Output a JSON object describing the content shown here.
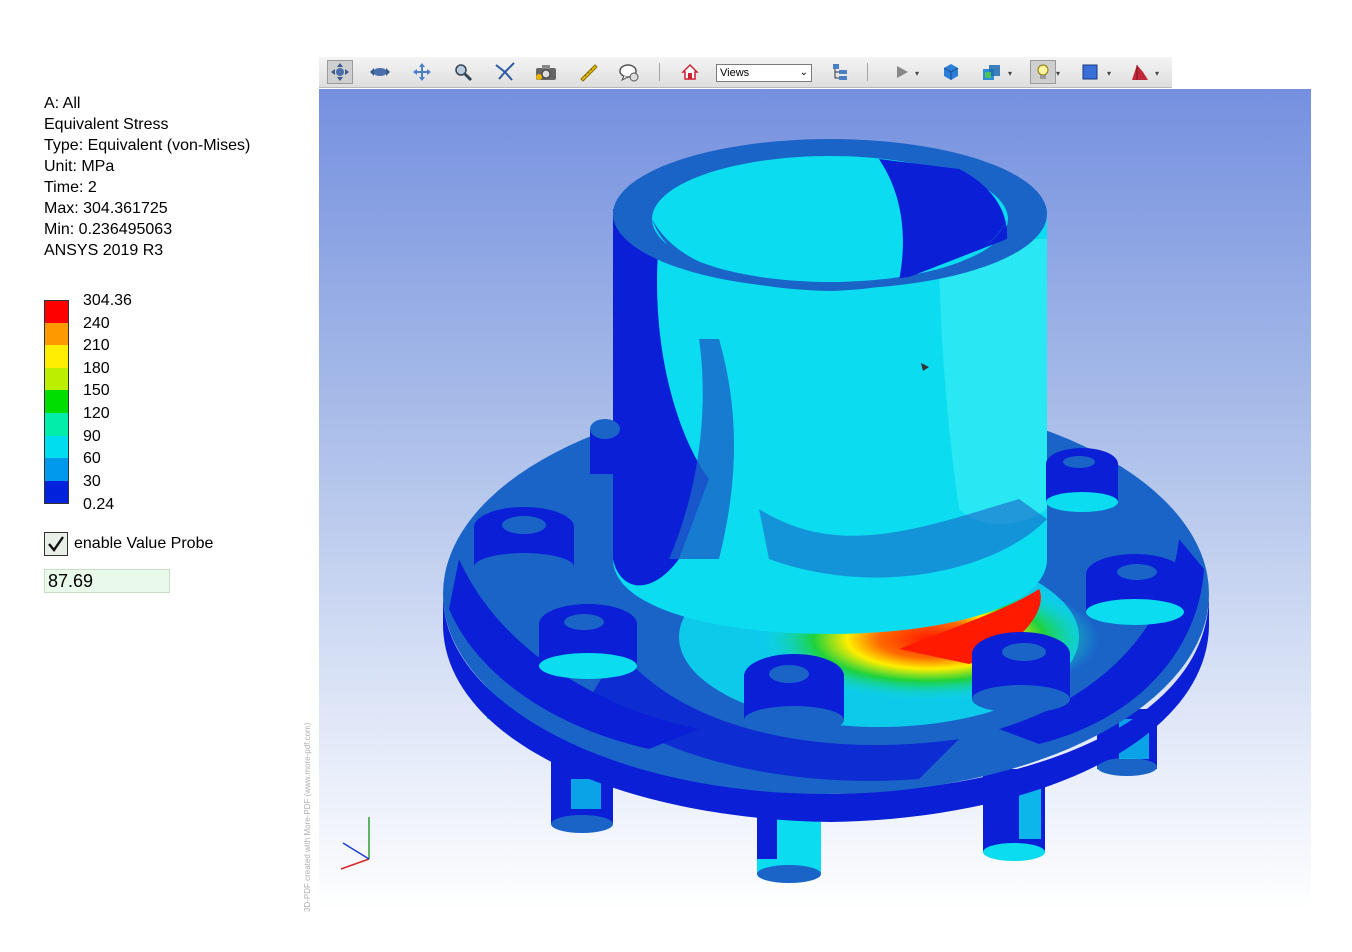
{
  "result_info": {
    "lines": [
      "A: All",
      "Equivalent Stress",
      "Type: Equivalent (von-Mises)",
      "Unit: MPa",
      "Time: 2",
      "Max: 304.361725",
      "Min: 0.236495063",
      "ANSYS 2019 R3"
    ]
  },
  "legend": {
    "labels": [
      "304.36",
      "240",
      "210",
      "180",
      "150",
      "120",
      "90",
      "60",
      "30",
      "0.24"
    ],
    "colors": [
      "#ff0000",
      "#ff9900",
      "#ffee00",
      "#bbee00",
      "#00dd00",
      "#00eeaa",
      "#00ddee",
      "#0099ee",
      "#0022dd"
    ]
  },
  "probe": {
    "checkbox_label": "enable Value Probe",
    "checked": true,
    "value": "87.69"
  },
  "toolbar": {
    "buttons": [
      "rotate-icon",
      "turn-icon",
      "pan-icon",
      "zoom-icon",
      "fly-icon",
      "camera-icon",
      "measure-icon",
      "comment-icon",
      "home-icon",
      "model-tree-icon",
      "play-icon",
      "render-mode-icon",
      "render-style-icon",
      "lighting-icon",
      "background-color-icon",
      "cross-section-icon"
    ],
    "views_label": "Views"
  },
  "viewport": {
    "watermark": "3D-PDF created with More-PDF (www.more-pdf.com)",
    "colors": {
      "dark_blue": "#0a1fd6",
      "steel_blue": "#1a64c8",
      "cyan": "#0cdcf0",
      "light_cyan": "#29e7f3",
      "green": "#1ed23c",
      "yellow": "#ffee00",
      "orange": "#ff8800",
      "red": "#ff1a00"
    }
  }
}
